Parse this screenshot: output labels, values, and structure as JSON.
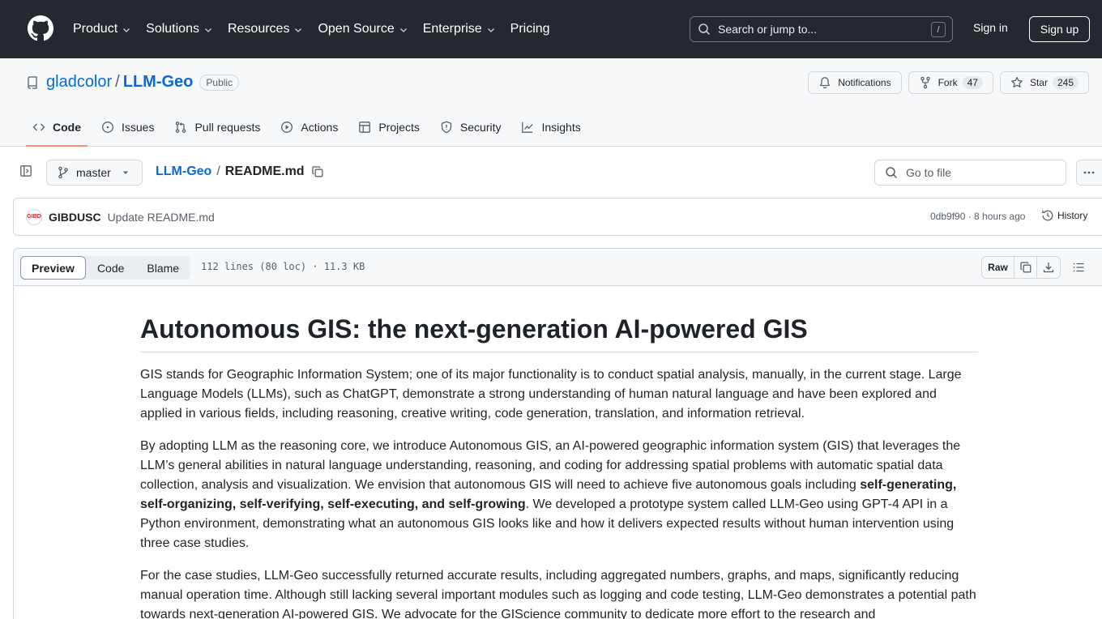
{
  "header": {
    "nav": [
      "Product",
      "Solutions",
      "Resources",
      "Open Source",
      "Enterprise",
      "Pricing"
    ],
    "nav_has_dropdown": [
      true,
      true,
      true,
      true,
      true,
      false
    ],
    "search_placeholder": "Search or jump to...",
    "search_shortcut": "/",
    "signin": "Sign in",
    "signup": "Sign up"
  },
  "repo": {
    "owner": "gladcolor",
    "separator": "/",
    "name": "LLM-Geo",
    "visibility": "Public",
    "notifications_label": "Notifications",
    "fork_label": "Fork",
    "fork_count": "47",
    "star_label": "Star",
    "star_count": "245",
    "tabs": [
      {
        "label": "Code",
        "icon": "code-icon",
        "active": true
      },
      {
        "label": "Issues",
        "icon": "issue-icon",
        "active": false
      },
      {
        "label": "Pull requests",
        "icon": "pull-request-icon",
        "active": false
      },
      {
        "label": "Actions",
        "icon": "play-icon",
        "active": false
      },
      {
        "label": "Projects",
        "icon": "table-icon",
        "active": false
      },
      {
        "label": "Security",
        "icon": "shield-icon",
        "active": false
      },
      {
        "label": "Insights",
        "icon": "graph-icon",
        "active": false
      }
    ]
  },
  "file_nav": {
    "branch": "master",
    "crumb_repo": "LLM-Geo",
    "crumb_sep": "/",
    "crumb_file": "README.md",
    "goto_placeholder": "Go to file"
  },
  "commit": {
    "avatar_text": "GIBD",
    "author": "GIBDUSC",
    "message": "Update README.md",
    "meta": "0db9f90 · 8 hours ago",
    "history_label": "History"
  },
  "file_view": {
    "tabs": [
      "Preview",
      "Code",
      "Blame"
    ],
    "active_tab": "Preview",
    "info": "112 lines (80 loc) · 11.3 KB",
    "raw_label": "Raw"
  },
  "readme": {
    "title": "Autonomous GIS: the next-generation AI-powered GIS",
    "p1": "GIS stands for Geographic Information System; one of its major functionality is to conduct spatial analysis, manually, in the current stage. Large Language Models (LLMs), such as ChatGPT, demonstrate a strong understanding of human natural language and have been explored and applied in various fields, including reasoning, creative writing, code generation, translation, and information retrieval.",
    "p2_before": "By adopting LLM as the reasoning core, we introduce Autonomous GIS, an AI-powered geographic information system (GIS) that leverages the LLM’s general abilities in natural language understanding, reasoning, and coding for addressing spatial problems with automatic spatial data collection, analysis and visualization. We envision that autonomous GIS will need to achieve five autonomous goals including ",
    "p2_bold": "self-generating, self-organizing, self-verifying, self-executing, and self-growing",
    "p2_after": ". We developed a prototype system called LLM-Geo using GPT-4 API in a Python environment, demonstrating what an autonomous GIS looks like and how it delivers expected results without human intervention using three case studies.",
    "p3": "For the case studies, LLM-Geo successfully returned accurate results, including aggregated numbers, graphs, and maps, significantly reducing manual operation time. Although still lacking several important modules such as logging and code testing, LLM-Geo demonstrates a potential path towards next-generation AI-powered GIS. We advocate for the GIScience community to dedicate more effort to the research and"
  }
}
